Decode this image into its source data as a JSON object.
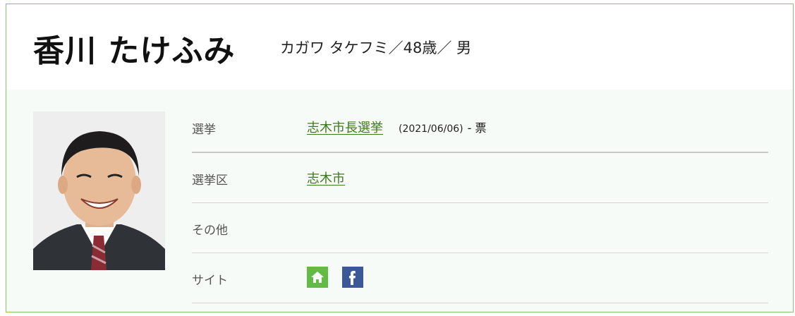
{
  "candidate": {
    "name": "香川 たけふみ",
    "subtitle": "カガワ タケフミ／48歳／ 男"
  },
  "profile": {
    "rows": [
      {
        "label": "選挙",
        "link_text": "志木市長選挙",
        "date": "(2021/06/06)",
        "votes": "- 票"
      },
      {
        "label": "選挙区",
        "link_text": "志木市"
      },
      {
        "label": "その他"
      },
      {
        "label": "サイト",
        "icons": [
          "home-icon",
          "facebook-icon"
        ]
      }
    ]
  },
  "colors": {
    "border": "#8dc06a",
    "link": "#3d7a1e",
    "home_icon_bg": "#62bb44",
    "facebook_icon_bg": "#3b5998"
  }
}
